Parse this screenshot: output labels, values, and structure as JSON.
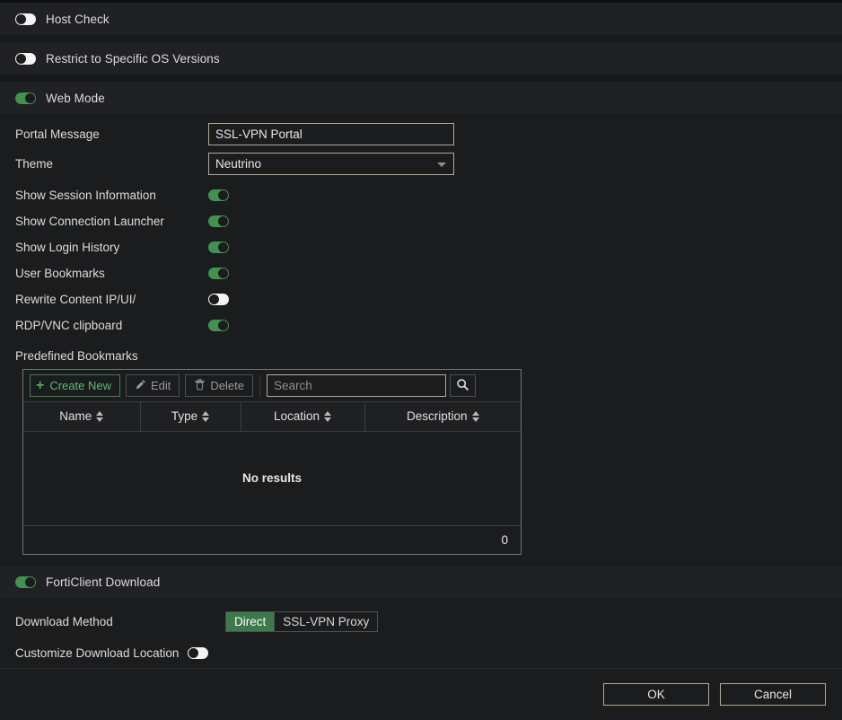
{
  "colors": {
    "accent_green": "#41914f",
    "page_bg": "#1b1c1e",
    "band_bg": "#202124",
    "field_border": "#b3ab92",
    "segment_active": "#3c7a4a"
  },
  "sections": {
    "host_check": {
      "label": "Host Check",
      "state": "off",
      "toggle_icon": "toggle-off-icon"
    },
    "restrict_os": {
      "label": "Restrict to Specific OS Versions",
      "state": "off",
      "toggle_icon": "toggle-off-icon"
    },
    "web_mode": {
      "label": "Web Mode",
      "state": "on",
      "toggle_icon": "toggle-on-icon"
    },
    "forticlient_download": {
      "label": "FortiClient Download",
      "state": "on",
      "toggle_icon": "toggle-on-icon"
    }
  },
  "web_mode": {
    "portal_message": {
      "label": "Portal Message",
      "value": "SSL-VPN Portal",
      "placeholder": ""
    },
    "theme": {
      "label": "Theme",
      "value": "Neutrino",
      "options": [
        "Neutrino"
      ],
      "caret_icon": "chevron-down-icon"
    },
    "toggles": [
      {
        "label": "Show Session Information",
        "state": "on"
      },
      {
        "label": "Show Connection Launcher",
        "state": "on"
      },
      {
        "label": "Show Login History",
        "state": "on"
      },
      {
        "label": "User Bookmarks",
        "state": "on"
      },
      {
        "label": "Rewrite Content IP/UI/",
        "state": "off"
      },
      {
        "label": "RDP/VNC clipboard",
        "state": "on"
      }
    ]
  },
  "predefined_bookmarks": {
    "title": "Predefined Bookmarks",
    "toolbar": {
      "create_new": {
        "label": "Create New",
        "icon": "plus-icon"
      },
      "edit": {
        "label": "Edit",
        "icon": "pencil-icon"
      },
      "delete": {
        "label": "Delete",
        "icon": "trash-icon"
      },
      "search": {
        "placeholder": "Search",
        "value": "",
        "button_icon": "search-icon"
      }
    },
    "columns": [
      {
        "label": "Name",
        "sort_icon": "sort-icon"
      },
      {
        "label": "Type",
        "sort_icon": "sort-icon"
      },
      {
        "label": "Location",
        "sort_icon": "sort-icon"
      },
      {
        "label": "Description",
        "sort_icon": "sort-icon"
      }
    ],
    "rows": [],
    "empty_message": "No results",
    "footer_count": "0"
  },
  "forticlient": {
    "download_method": {
      "label": "Download Method",
      "options": [
        {
          "label": "Direct",
          "active": true
        },
        {
          "label": "SSL-VPN Proxy",
          "active": false
        }
      ]
    },
    "customize_location": {
      "label": "Customize Download Location",
      "state": "off"
    }
  },
  "footer": {
    "ok": "OK",
    "cancel": "Cancel"
  }
}
